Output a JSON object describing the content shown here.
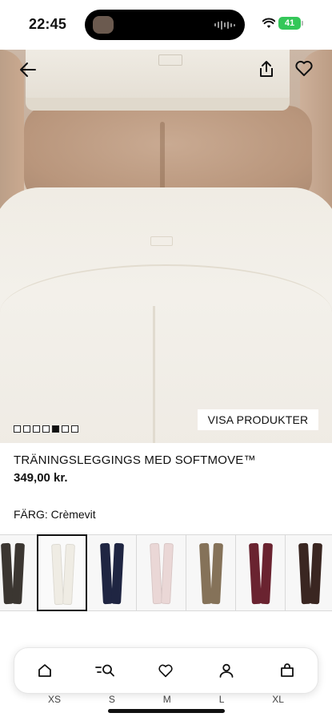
{
  "status_bar": {
    "time": "22:45",
    "battery": "41"
  },
  "product": {
    "title": "TRÄNINGSLEGGINGS MED SOFTMOVE™",
    "price": "349,00 kr.",
    "color_label": "FÄRG: Crèmevit",
    "visa_produkter": "VISA PRODUKTER",
    "image_count": 7,
    "active_image_index": 4
  },
  "swatches": [
    {
      "color": "#3b3631"
    },
    {
      "color": "#efece4",
      "selected": true
    },
    {
      "color": "#1f2542"
    },
    {
      "color": "#ead7d6"
    },
    {
      "color": "#857259"
    },
    {
      "color": "#6a2330"
    },
    {
      "color": "#3a2621"
    }
  ],
  "sizes": [
    "XS",
    "S",
    "M",
    "L",
    "XL"
  ],
  "tabbar": {
    "items": [
      "home-icon",
      "search-icon",
      "heart-icon",
      "account-icon",
      "bag-icon"
    ]
  },
  "icons": {
    "back": "arrow-left-icon",
    "share": "share-icon",
    "favorite": "heart-icon"
  }
}
